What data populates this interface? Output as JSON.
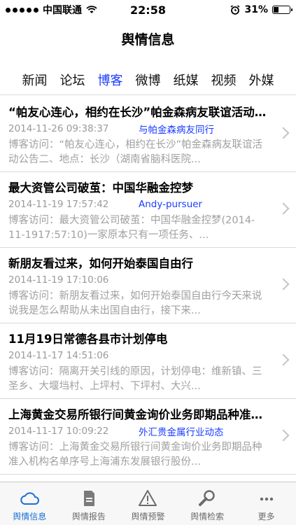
{
  "status_bar": {
    "carrier": "中国联通",
    "time": "22:58",
    "battery": "31%",
    "battery_level": 0.31
  },
  "header": {
    "title": "舆情信息"
  },
  "tabs": [
    {
      "label": "新闻"
    },
    {
      "label": "论坛"
    },
    {
      "label": "博客"
    },
    {
      "label": "微博"
    },
    {
      "label": "纸媒"
    },
    {
      "label": "视频"
    },
    {
      "label": "外媒"
    }
  ],
  "items": [
    {
      "title": "“帕友心连心，相约在长沙”帕金森病友联谊活动公告",
      "date": "2014-11-26 09:38:37",
      "author": "与帕金森病友同行",
      "summary": "博客访问：“帕友心连心，相约在长沙”帕金森病友联谊活动公告二、地点：长沙（湖南省脑科医院..."
    },
    {
      "title": "最大资管公司破茧：中国华融金控梦",
      "date": "2014-11-19 17:57:42",
      "author": "Andy-pursuer",
      "summary": "博客访问：最大资管公司破茧：中国华融金控梦(2014-11-1917:57:10)一家原本只有一项任务、..."
    },
    {
      "title": "新朋友看过来，如何开始泰国自由行",
      "date": "2014-11-19 17:10:06",
      "author": "",
      "summary": "博客访问：新朋友看过来，如何开始泰国自由行今天来说说我是怎么帮助从未出国自由行，接下来..."
    },
    {
      "title": "11月19日常德各县市计划停电",
      "date": "2014-11-17 14:51:06",
      "author": "",
      "summary": "博客访问：隔离开关引线的原因，计划停电：维新镇、三圣乡、大堰垱村、上坪村、下坪村、大兴..."
    },
    {
      "title": "上海黄金交易所银行间黄金询价业务即期品种准入机构",
      "date": "2014-11-17 10:09:22",
      "author": "外汇贵金属行业动态",
      "summary": "博客访问：上海黄金交易所银行间黄金询价业务即期品种准入机构名单序号上海浦东发展银行股份..."
    }
  ],
  "tabbar": [
    {
      "label": "舆情信息",
      "icon": "cloud-icon"
    },
    {
      "label": "舆情报告",
      "icon": "report-icon"
    },
    {
      "label": "舆情预警",
      "icon": "warning-icon"
    },
    {
      "label": "舆情检索",
      "icon": "search-icon"
    },
    {
      "label": "更多",
      "icon": "more-icon"
    }
  ],
  "colors": {
    "accent": "#1a3cff",
    "tabbar_active": "#1a6fd6"
  }
}
